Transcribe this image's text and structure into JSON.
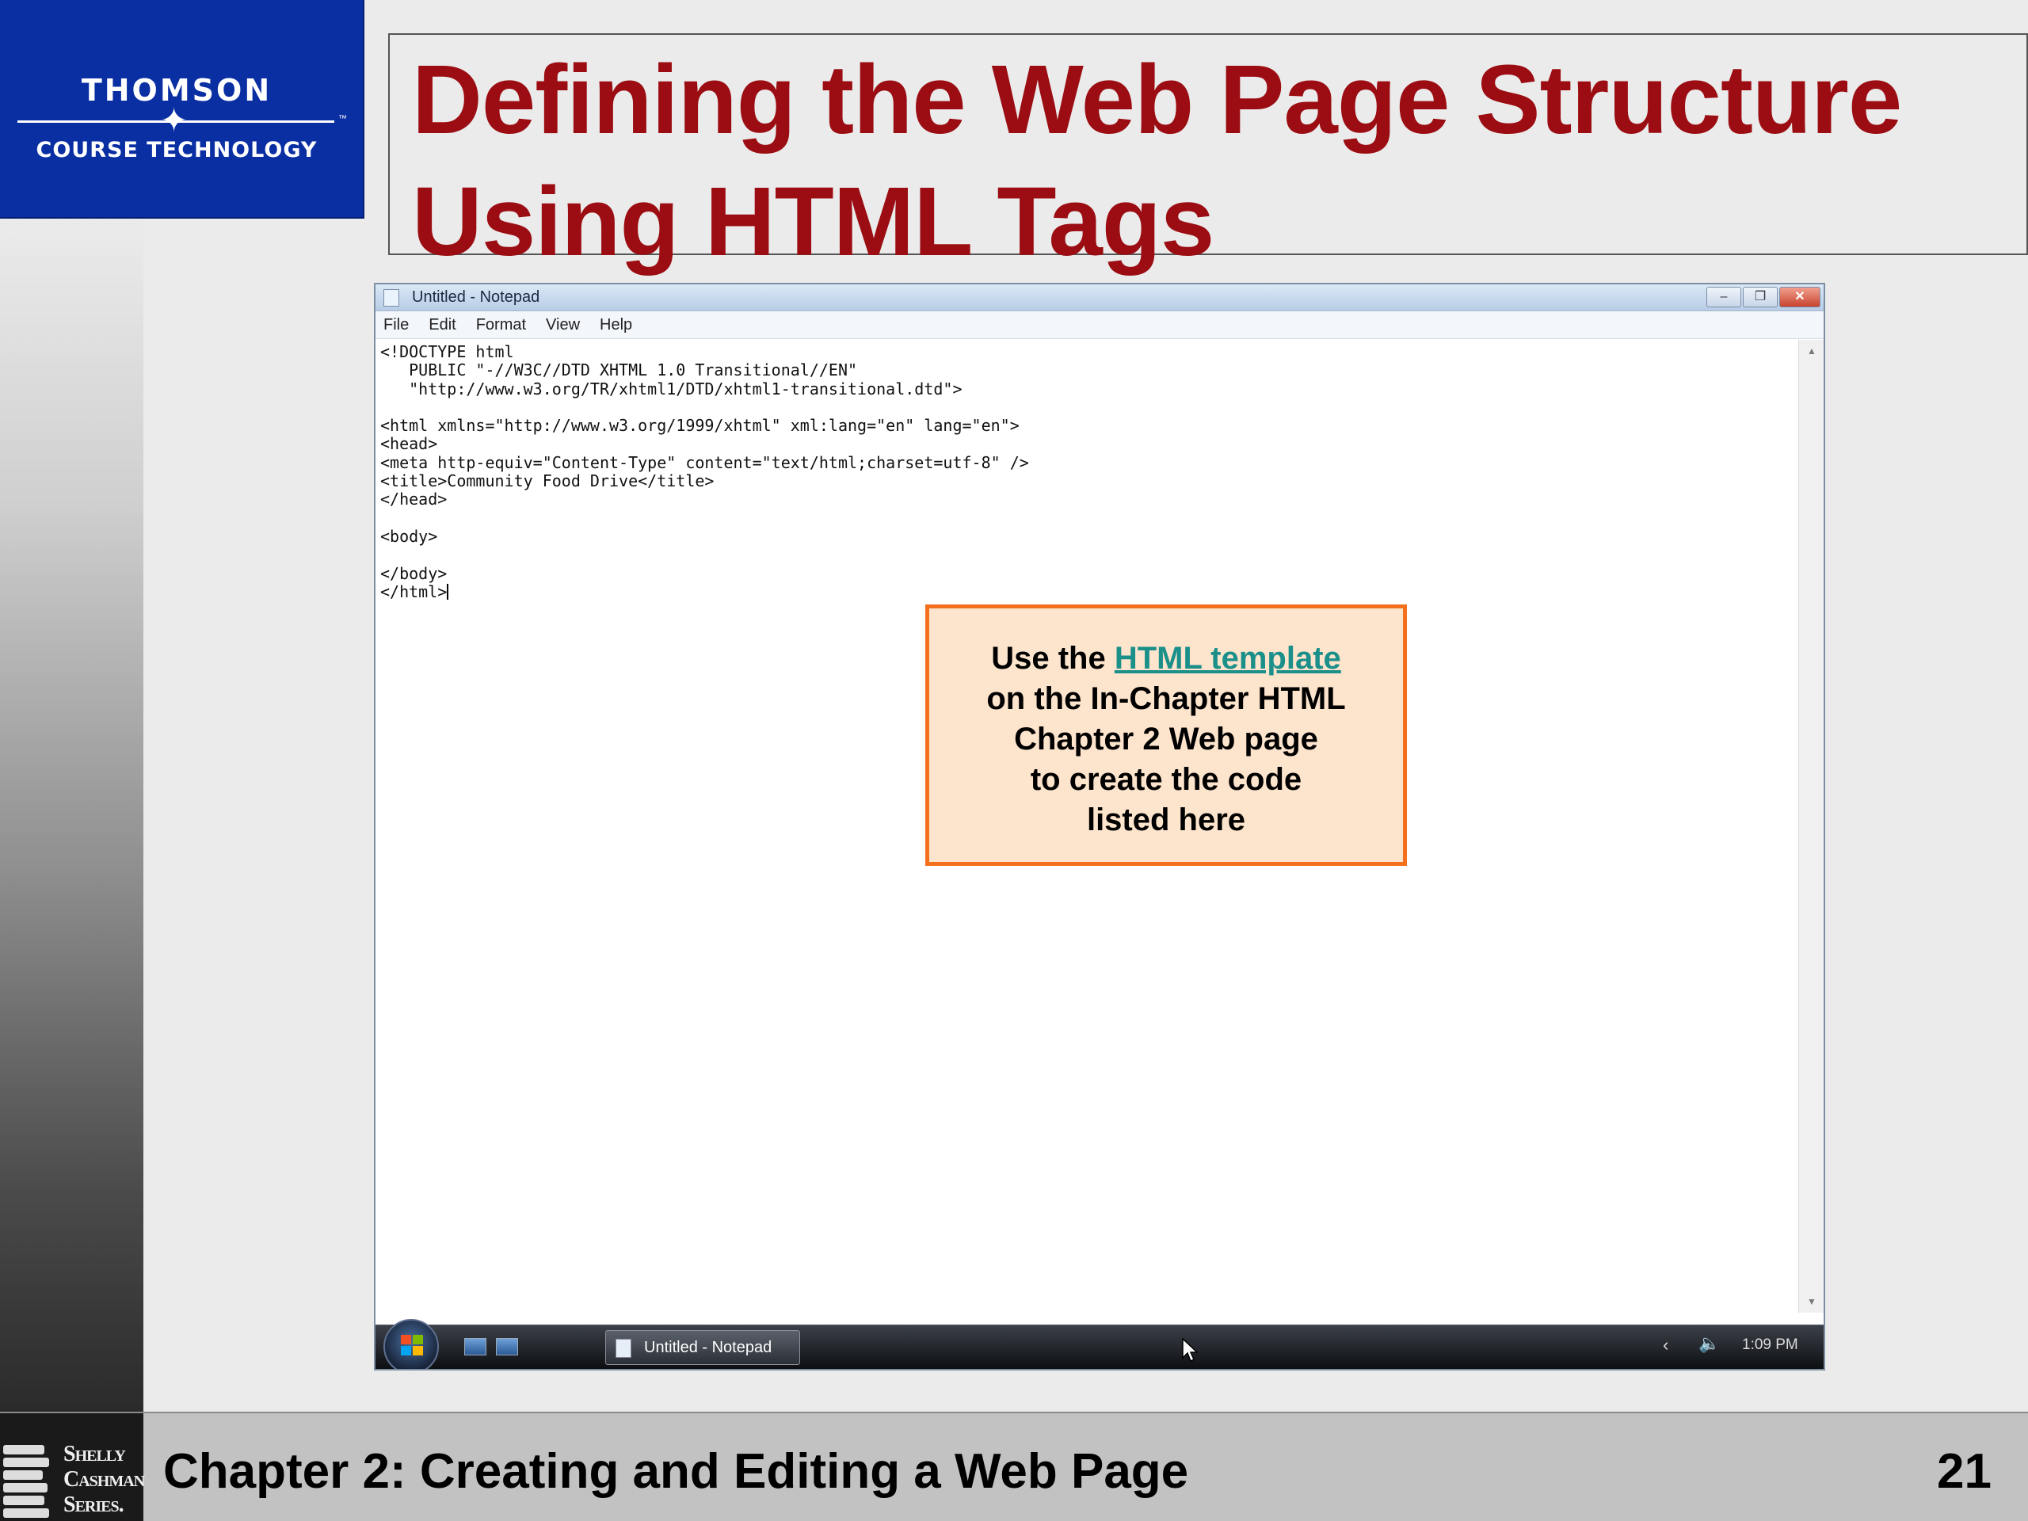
{
  "logo": {
    "top": "THOMSON",
    "bottom": "COURSE TECHNOLOGY",
    "tm": "™"
  },
  "slide_title": {
    "line1": "Defining the Web Page Structure",
    "line2": "Using HTML Tags"
  },
  "notepad": {
    "window_title": "Untitled - Notepad",
    "menu": [
      "File",
      "Edit",
      "Format",
      "View",
      "Help"
    ],
    "code_lines": [
      "<!DOCTYPE html",
      "   PUBLIC \"-//W3C//DTD XHTML 1.0 Transitional//EN\"",
      "   \"http://www.w3.org/TR/xhtml1/DTD/xhtml1-transitional.dtd\">",
      "",
      "<html xmlns=\"http://www.w3.org/1999/xhtml\" xml:lang=\"en\" lang=\"en\">",
      "<head>",
      "<meta http-equiv=\"Content-Type\" content=\"text/html;charset=utf-8\" />",
      "<title>Community Food Drive</title>",
      "</head>",
      "",
      "<body>",
      "",
      "</body>",
      "</html>"
    ]
  },
  "taskbar": {
    "task_label": "Untitled - Notepad",
    "clock": "1:09 PM"
  },
  "callout": {
    "prefix": "Use the ",
    "link": "HTML template",
    "line2": "on the In-Chapter HTML",
    "line3": "Chapter 2 Web page",
    "line4": "to create the code",
    "line5": "listed here"
  },
  "series": {
    "line1": "Shelly",
    "line2": "Cashman",
    "line3": "Series."
  },
  "footer": {
    "text": "Chapter 2: Creating and Editing a Web Page",
    "page": "21"
  },
  "colors": {
    "title": "#9b0d12",
    "logo_bg": "#0a2fa3",
    "callout_bg": "#fde4cc",
    "callout_border": "#f4701c",
    "link": "#1b8f8a"
  }
}
